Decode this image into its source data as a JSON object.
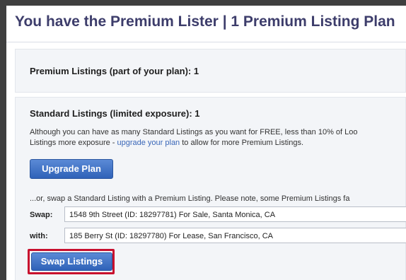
{
  "header": {
    "title": "You have the Premium Lister | 1 Premium Listing Plan"
  },
  "premium": {
    "heading": "Premium Listings (part of your plan): 1"
  },
  "standard": {
    "heading": "Standard Listings (limited exposure): 1",
    "desc_line1": "Although you can have as many Standard Listings as you want for FREE, less than 10% of Loo",
    "desc_line2_before": "Listings more exposure - ",
    "desc_link": "upgrade your plan",
    "desc_line2_after": " to allow for more Premium Listings.",
    "upgrade_label": "Upgrade Plan",
    "note": "...or, swap a Standard Listing with a Premium Listing. Please note, some Premium Listings fa",
    "swap_label": "Swap:",
    "swap_value": "1548 9th Street (ID: 18297781) For Sale, Santa Monica, CA",
    "with_label": "with:",
    "with_value": "185 Berry St (ID: 18297780) For Lease, San Francisco, CA",
    "swap_button_label": "Swap Listings"
  },
  "colors": {
    "title": "#3d3d6b",
    "button": "#2f62b8",
    "highlight": "#c8102e",
    "link": "#3a67b8"
  }
}
